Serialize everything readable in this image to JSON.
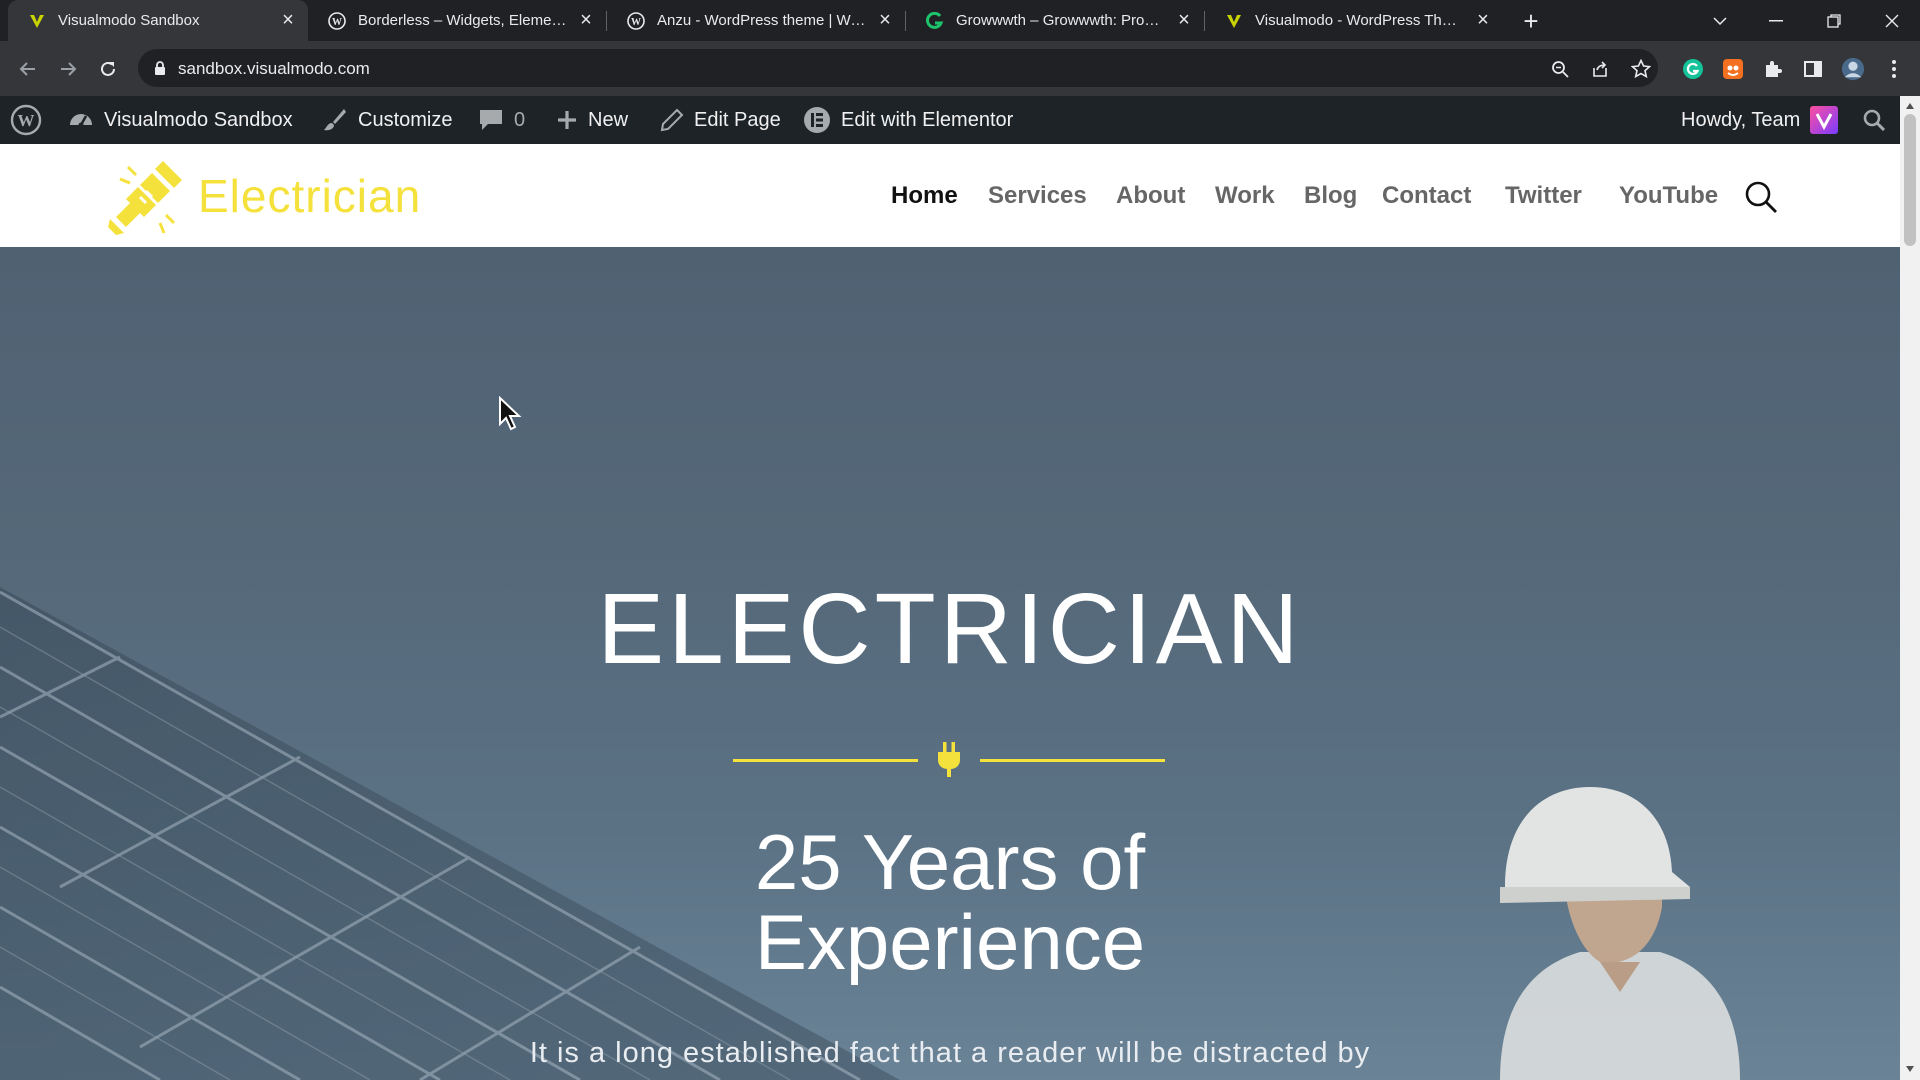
{
  "browser": {
    "tabs": [
      {
        "title": "Visualmodo Sandbox",
        "icon": "visualmodo-v-icon",
        "active": true
      },
      {
        "title": "Borderless – Widgets, Elements, T",
        "icon": "wordpress-icon",
        "active": false
      },
      {
        "title": "Anzu - WordPress theme | WordP",
        "icon": "wordpress-icon",
        "active": false
      },
      {
        "title": "Growwwth – Growwwth: Program",
        "icon": "growwwth-icon",
        "active": false
      },
      {
        "title": "Visualmodo - WordPress Themes",
        "icon": "visualmodo-v-icon",
        "active": false
      }
    ],
    "url": "sandbox.visualmodo.com"
  },
  "adminbar": {
    "site_name": "Visualmodo Sandbox",
    "customize": "Customize",
    "comments_count": "0",
    "new": "New",
    "edit_page": "Edit Page",
    "edit_elementor": "Edit with Elementor",
    "howdy": "Howdy, Team"
  },
  "site": {
    "logo_text": "Electrician",
    "nav": [
      "Home",
      "Services",
      "About",
      "Work",
      "Blog",
      "Contact",
      "Twitter",
      "YouTube"
    ],
    "hero": {
      "title": "ELECTRICIAN",
      "subtitle_line1": "25 Years of",
      "subtitle_line2": "Experience",
      "text": "It is a long established fact that a reader will be distracted by"
    }
  },
  "colors": {
    "accent": "#f5e13b",
    "adminbar_bg": "#1d2327",
    "browser_bg": "#202124"
  }
}
